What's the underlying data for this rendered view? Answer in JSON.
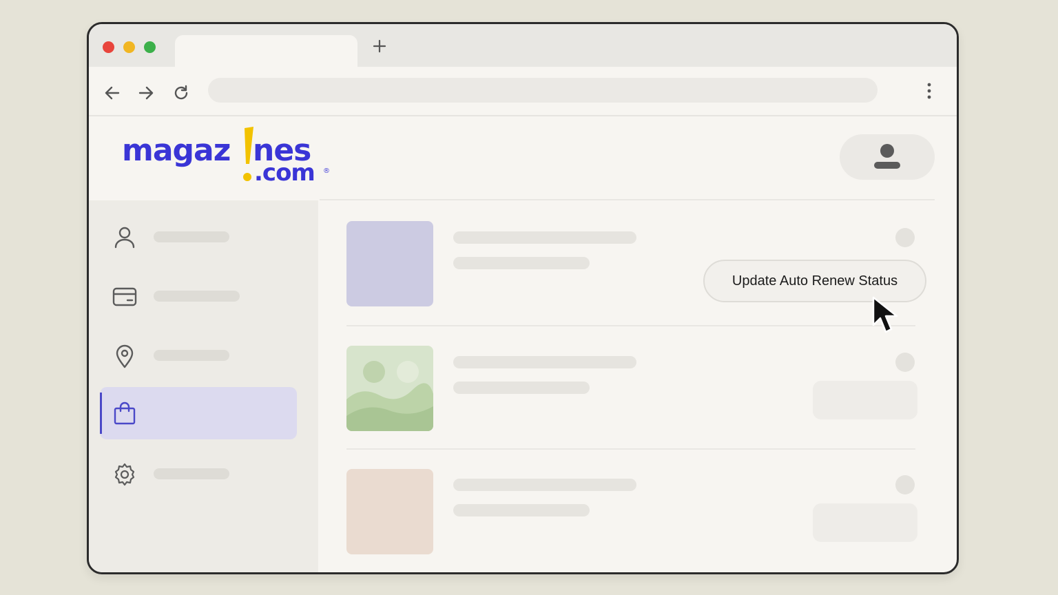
{
  "browser": {
    "tab_title": "",
    "url": "",
    "icons": [
      "close-dot",
      "minimize-dot",
      "maximize-dot",
      "plus-icon",
      "back-arrow-icon",
      "forward-arrow-icon",
      "reload-icon",
      "kebab-menu-icon"
    ]
  },
  "header": {
    "logo_text_main": "magaz!nes",
    "logo_text_sub": ".com",
    "logo_registered": "®",
    "brand_color": "#3a35d6",
    "accent_color": "#f2c200",
    "avatar_icon": "user-avatar-icon"
  },
  "sidebar": {
    "items": [
      {
        "icon": "user-icon",
        "label": "",
        "active": false
      },
      {
        "icon": "credit-card-icon",
        "label": "",
        "active": false
      },
      {
        "icon": "location-pin-icon",
        "label": "",
        "active": false
      },
      {
        "icon": "shopping-bag-icon",
        "label": "",
        "active": true
      },
      {
        "icon": "gear-icon",
        "label": "",
        "active": false
      }
    ]
  },
  "subscriptions": {
    "rows": [
      {
        "thumb_color": "#cccbe2",
        "action": "Update Auto Renew Status"
      },
      {
        "thumb_color": "#d7e4cc",
        "thumb_icon": "landscape-image-icon",
        "action": ""
      },
      {
        "thumb_color": "#eadbd0",
        "action": ""
      }
    ]
  },
  "cursor": {
    "icon": "mouse-pointer-icon"
  }
}
